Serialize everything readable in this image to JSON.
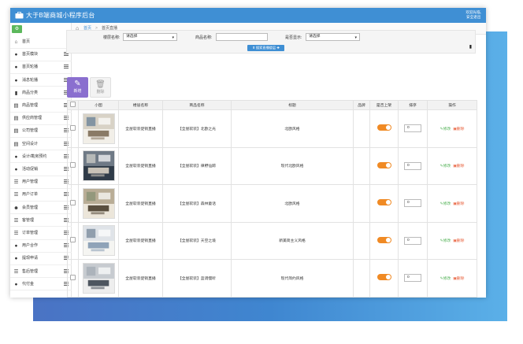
{
  "app": {
    "title": "大于B端商城小程序后台",
    "user_line1": "欢迎光临,",
    "user_line2": "安全退出"
  },
  "sidebar": {
    "items": [
      {
        "label": "首页",
        "icon": "home-icon",
        "has_sub": false
      },
      {
        "label": "首页模块",
        "icon": "globe-icon",
        "has_sub": true
      },
      {
        "label": "首页轮播",
        "icon": "globe-icon",
        "has_sub": true
      },
      {
        "label": "消息轮播",
        "icon": "globe-icon",
        "has_sub": true
      },
      {
        "label": "商品分类",
        "icon": "bookmark-icon",
        "has_sub": true
      },
      {
        "label": "商品管理",
        "icon": "document-icon",
        "has_sub": true
      },
      {
        "label": "供应商管理",
        "icon": "document-icon",
        "has_sub": true
      },
      {
        "label": "公司管理",
        "icon": "document-icon",
        "has_sub": true
      },
      {
        "label": "空间设计",
        "icon": "document-icon",
        "has_sub": true
      },
      {
        "label": "设计/勘房预约",
        "icon": "globe-icon",
        "has_sub": true
      },
      {
        "label": "活动促销",
        "icon": "globe-icon",
        "has_sub": true
      },
      {
        "label": "用户管理",
        "icon": "list-icon",
        "has_sub": true
      },
      {
        "label": "用户订单",
        "icon": "list-icon",
        "has_sub": true
      },
      {
        "label": "会员管理",
        "icon": "user-icon",
        "has_sub": true
      },
      {
        "label": "客管理",
        "icon": "list-icon",
        "has_sub": true
      },
      {
        "label": "订单管理",
        "icon": "list-icon",
        "has_sub": true
      },
      {
        "label": "用户合作",
        "icon": "globe-icon",
        "has_sub": true
      },
      {
        "label": "提现申请",
        "icon": "globe-icon",
        "has_sub": true
      },
      {
        "label": "售后管理",
        "icon": "list-icon",
        "has_sub": true
      },
      {
        "label": "代付金",
        "icon": "globe-icon",
        "has_sub": true
      }
    ]
  },
  "breadcrumb": {
    "home": "首页",
    "sep": ">",
    "current": "首页直播"
  },
  "filters": {
    "floor_label": "楼层名称:",
    "floor_value": "请选择",
    "product_label": "商品名称:",
    "product_value": "",
    "show_label": "是否显示:",
    "show_value": "请选择",
    "search_button": "搜索直播楼层"
  },
  "toolbar": {
    "add_label": "新增",
    "delete_label": "删除"
  },
  "table": {
    "headers": [
      "小图",
      "楼层名称",
      "商品名称",
      "标题",
      "品牌",
      "是否上架",
      "排序",
      "操作"
    ],
    "rows": [
      {
        "floor": "全屋软装促销直播",
        "product": "【全屋软装】北欧之光",
        "title": "北欧风格",
        "brand": "",
        "on_shelf": true,
        "sort": "0"
      },
      {
        "floor": "全屋软装促销直播",
        "product": "【全屋软装】律野仙踪",
        "title": "现代北欧风格",
        "brand": "",
        "on_shelf": true,
        "sort": "0"
      },
      {
        "floor": "全屋软装促销直播",
        "product": "【全屋软装】森林童话",
        "title": "北欧风格",
        "brand": "",
        "on_shelf": true,
        "sort": "0"
      },
      {
        "floor": "全屋软装促销直播",
        "product": "【全屋软装】天空之境",
        "title": "新美简主义风格",
        "brand": "",
        "on_shelf": true,
        "sort": "0"
      },
      {
        "floor": "全屋软装促销直播",
        "product": "【全屋软装】蓝调慢听",
        "title": "现代简约风格",
        "brand": "",
        "on_shelf": true,
        "sort": "0"
      }
    ],
    "edit_label": "修改",
    "delete_label": "删除"
  },
  "colors": {
    "topbar": "#3f8fd4",
    "add_button": "#8a6fcf",
    "toggle_on": "#f08a24",
    "edit": "#4caf50",
    "delete": "#e8603c"
  }
}
